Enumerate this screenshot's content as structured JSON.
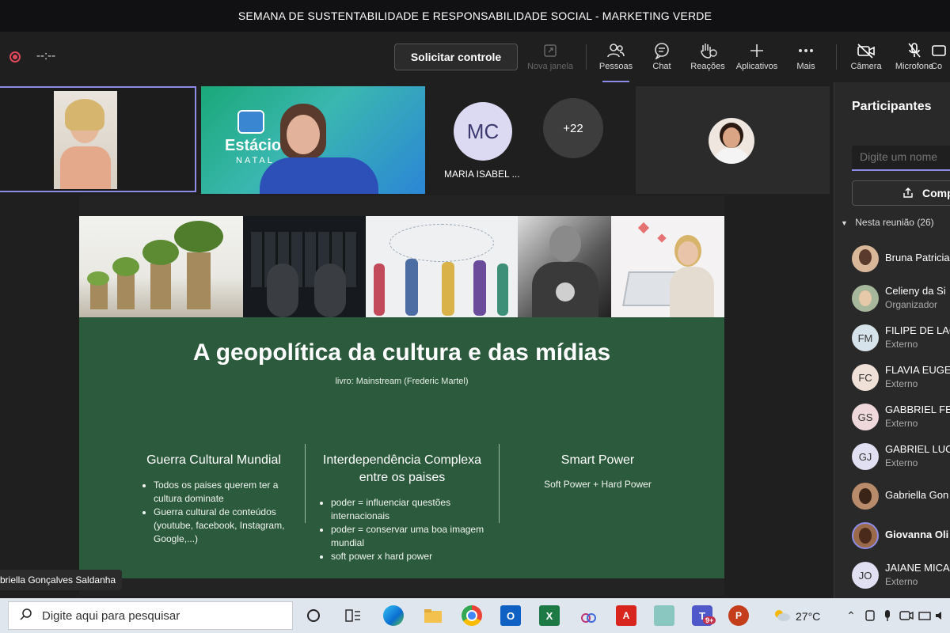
{
  "window": {
    "title": "SEMANA DE SUSTENTABILIDADE E RESPONSABILIDADE SOCIAL - MARKETING VERDE"
  },
  "toolbar": {
    "timer": "--:--",
    "request_control": "Solicitar controle",
    "items": [
      {
        "label": "Nova janela",
        "icon": "new-window-icon"
      },
      {
        "label": "Pessoas",
        "icon": "people-icon"
      },
      {
        "label": "Chat",
        "icon": "chat-icon"
      },
      {
        "label": "Reações",
        "icon": "raise-hand-icon"
      },
      {
        "label": "Aplicativos",
        "icon": "plus-icon"
      },
      {
        "label": "Mais",
        "icon": "more-icon"
      },
      {
        "label": "Câmera",
        "icon": "camera-off-icon"
      },
      {
        "label": "Microfone",
        "icon": "mic-off-icon"
      },
      {
        "label": "Co",
        "icon": "share-icon"
      }
    ]
  },
  "stage": {
    "tiles": [
      {
        "type": "video"
      },
      {
        "type": "video",
        "brand": "Estácio",
        "brand_sub": "NATAL"
      },
      {
        "type": "initials",
        "initials": "MC",
        "name": "MARIA ISABEL ..."
      },
      {
        "type": "overflow",
        "count": "+22"
      },
      {
        "type": "avatar"
      }
    ],
    "presenter_name": "briella Gonçalves Saldanha"
  },
  "slide": {
    "title": "A geopolítica da cultura e das mídias",
    "subtitle": "livro: Mainstream (Frederic Martel)",
    "columns": [
      {
        "heading": "Guerra Cultural Mundial",
        "bullets": [
          "Todos os paises querem ter a cultura dominate",
          "Guerra cultural de conteúdos (youtube, facebook, Instagram, Google,...)"
        ]
      },
      {
        "heading": "Interdependência Complexa entre os paises",
        "bullets": [
          "poder = influenciar questões internacionais",
          "poder = conservar uma boa imagem mundial",
          "soft power x hard power"
        ]
      },
      {
        "heading": "Smart Power",
        "text": "Soft Power + Hard Power"
      }
    ]
  },
  "participants": {
    "title": "Participantes",
    "search_placeholder": "Digite um nome",
    "share_label": "Comp",
    "section_label": "Nesta reunião (26)",
    "list": [
      {
        "name": "Bruna Patricia",
        "role": "",
        "initials": "",
        "avatar_color": "#d9b89a"
      },
      {
        "name": "Celieny da Si",
        "role": "Organizador",
        "initials": "",
        "avatar_color": "#a7b79b"
      },
      {
        "name": "FILIPE DE LAC",
        "role": "Externo",
        "initials": "FM",
        "avatar_color": "#d7e3ea"
      },
      {
        "name": "FLAVIA EUGE",
        "role": "Externo",
        "initials": "FC",
        "avatar_color": "#efe1d7"
      },
      {
        "name": "GABBRIEL FE",
        "role": "Externo",
        "initials": "GS",
        "avatar_color": "#efd8dc"
      },
      {
        "name": "GABRIEL LUC",
        "role": "Externo",
        "initials": "GJ",
        "avatar_color": "#e1dff2"
      },
      {
        "name": "Gabriella Gon",
        "role": "",
        "initials": "",
        "avatar_color": "#b88b6b"
      },
      {
        "name": "Giovanna Oli",
        "role": "",
        "initials": "",
        "avatar_color": "#9a6a4a"
      },
      {
        "name": "JAIANE MICA",
        "role": "Externo",
        "initials": "JO",
        "avatar_color": "#e1dff2"
      }
    ]
  },
  "taskbar": {
    "search_placeholder": "Digite aqui para pesquisar",
    "weather": "27°C",
    "teams_badge": "9+"
  }
}
